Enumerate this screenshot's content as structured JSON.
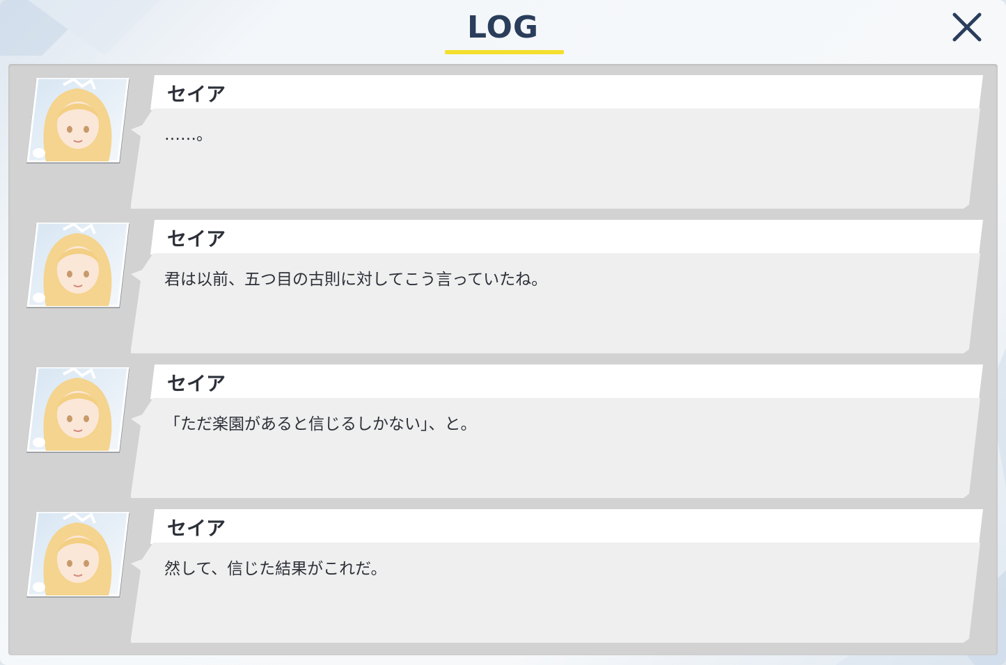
{
  "header": {
    "title": "LOG",
    "close_icon": "close-icon"
  },
  "colors": {
    "title": "#2a3d5b",
    "accent_underline": "#f3df2c",
    "panel_bg": "#d2d2d2",
    "name_bar_bg": "#ffffff",
    "bubble_bg": "#efefef",
    "text": "#2c3038"
  },
  "log": {
    "entries": [
      {
        "speaker": "セイア",
        "text": "……。",
        "avatar_icon": "character-portrait-icon"
      },
      {
        "speaker": "セイア",
        "text": "君は以前、五つ目の古則に対してこう言っていたね。",
        "avatar_icon": "character-portrait-icon"
      },
      {
        "speaker": "セイア",
        "text": "「ただ楽園があると信じるしかない」、と。",
        "avatar_icon": "character-portrait-icon"
      },
      {
        "speaker": "セイア",
        "text": "然して、信じた結果がこれだ。",
        "avatar_icon": "character-portrait-icon"
      }
    ]
  }
}
